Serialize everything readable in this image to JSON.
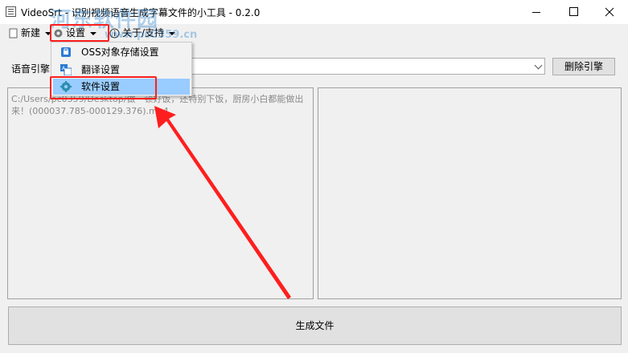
{
  "window": {
    "title": "VideoSrt - 识别视频语音生成字幕文件的小工具 - 0.2.0"
  },
  "menu": {
    "new_label": "新建",
    "settings_label": "设置",
    "about_label": "关于/支持"
  },
  "settings_menu": {
    "items": [
      {
        "label": "OSS对象存储设置",
        "icon": "database-icon"
      },
      {
        "label": "翻译设置",
        "icon": "translate-icon"
      },
      {
        "label": "软件设置",
        "icon": "gear-icon",
        "selected": true
      }
    ]
  },
  "engine": {
    "label": "语音引擎",
    "selected_value": "",
    "delete_label": "删除引擎"
  },
  "file": {
    "path": "C:/Users/pc0359/Desktop/做一顿好饭，还特别下饭，厨房小白都能做出来！(000037.785-000129.376).mp4"
  },
  "actions": {
    "generate_label": "生成文件"
  },
  "watermark": {
    "text": "河东软件园",
    "url": "www.pc0359.cn"
  },
  "colors": {
    "highlight": "#ff1e1e",
    "selected_item": "#99ccff",
    "window_bg": "#f0f0f0"
  }
}
